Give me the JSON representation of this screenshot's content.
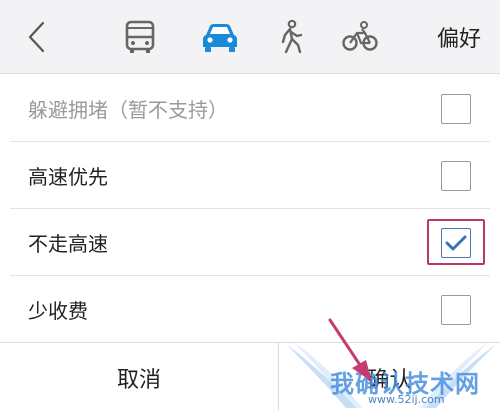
{
  "topbar": {
    "preference_label": "偏好",
    "icons": {
      "back": "chevron-left-icon",
      "bus": "bus-icon",
      "car": "car-icon",
      "walk": "pedestrian-icon",
      "bike": "bicycle-icon"
    },
    "selected_mode": "car"
  },
  "options": [
    {
      "label": "躲避拥堵（暂不支持）",
      "checked": false,
      "disabled": true
    },
    {
      "label": "高速优先",
      "checked": false,
      "disabled": false
    },
    {
      "label": "不走高速",
      "checked": true,
      "disabled": false
    },
    {
      "label": "少收费",
      "checked": false,
      "disabled": false
    }
  ],
  "bottombar": {
    "cancel_label": "取消",
    "confirm_label": "确认"
  },
  "watermark": {
    "text": "我确认技术网",
    "url": "www.52ij.com"
  },
  "colors": {
    "accent_blue": "#1a8ad8",
    "checkbox_check": "#4a78b3",
    "highlight_box": "#b8386c",
    "arrow": "#c83a72"
  }
}
